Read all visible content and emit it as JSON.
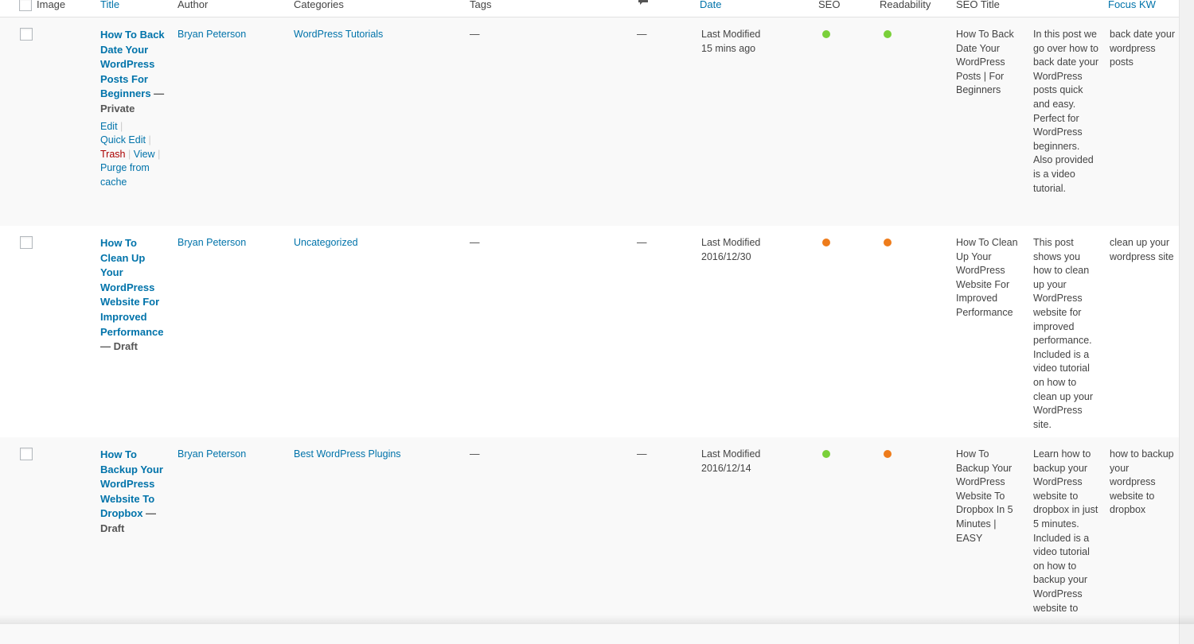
{
  "header": {
    "image": "Image",
    "title": "Title",
    "author": "Author",
    "categories": "Categories",
    "tags": "Tags",
    "date": "Date",
    "seo": "SEO",
    "readability": "Readability",
    "seo_title": "SEO Title",
    "focus_kw": "Focus KW"
  },
  "colors": {
    "good": "#7ad03a",
    "bad": "#ee7c1b",
    "link": "#0073aa"
  },
  "rows": [
    {
      "title": "How To Back Date Your WordPress Posts For Beginners",
      "state": "— Private",
      "author": "Bryan Peterson",
      "category": "WordPress Tutorials",
      "tags": "—",
      "comments": "—",
      "date_label": "Last Modified",
      "date_value": "15 mins ago",
      "seo_status": "good",
      "readability_status": "good",
      "seo_title": "How To Back Date Your WordPress Posts | For Beginners",
      "meta_desc": "In this post we go over how to back date your WordPress posts quick and easy. Perfect for WordPress beginners. Also provided is a video tutorial.",
      "focus_kw": "back date your wordpress posts",
      "actions": {
        "edit": "Edit",
        "quick_edit": "Quick Edit",
        "trash": "Trash",
        "view": "View",
        "purge": "Purge from cache",
        "sep": "|"
      }
    },
    {
      "title": "How To Clean Up Your WordPress Website For Improved Performance",
      "state": "— Draft",
      "author": "Bryan Peterson",
      "category": "Uncategorized",
      "tags": "—",
      "comments": "—",
      "date_label": "Last Modified",
      "date_value": "2016/12/30",
      "seo_status": "bad",
      "readability_status": "bad",
      "seo_title": "How To Clean Up Your WordPress Website For Improved Performance",
      "meta_desc": "This post shows you how to clean up your WordPress website for improved performance. Included is a video tutorial on how to clean up your WordPress site.",
      "focus_kw": "clean up your wordpress site"
    },
    {
      "title": "How To Backup Your WordPress Website To Dropbox",
      "state": "— Draft",
      "author": "Bryan Peterson",
      "category": "Best WordPress Plugins",
      "tags": "—",
      "comments": "—",
      "date_label": "Last Modified",
      "date_value": "2016/12/14",
      "seo_status": "good",
      "readability_status": "bad",
      "seo_title": "How To Backup Your WordPress Website To Dropbox In 5 Minutes | EASY",
      "meta_desc": "Learn how to backup your WordPress website to dropbox in just 5 minutes. Included is a video tutorial on how to backup your WordPress website to",
      "focus_kw": "how to backup your wordpress website to dropbox"
    }
  ]
}
